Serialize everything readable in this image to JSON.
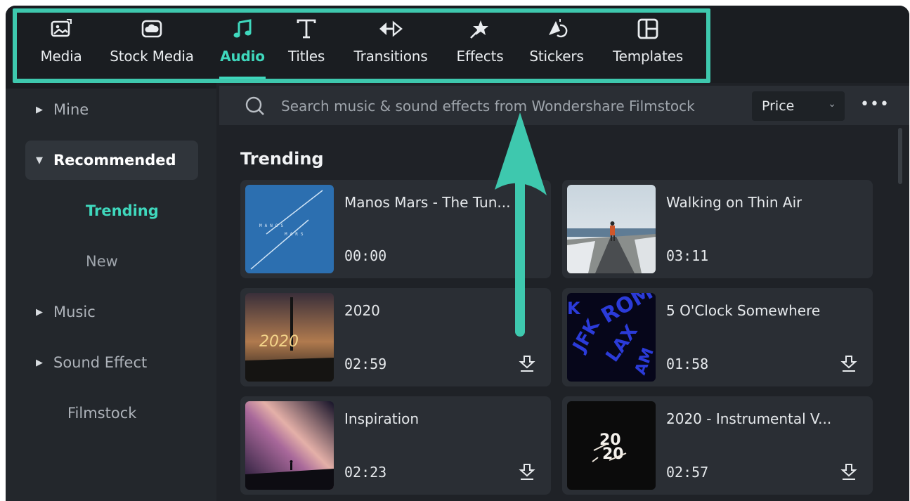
{
  "toolbar": {
    "tabs": [
      {
        "label": "Media",
        "icon": "media-icon"
      },
      {
        "label": "Stock Media",
        "icon": "stock-media-icon"
      },
      {
        "label": "Audio",
        "icon": "music-note-icon",
        "active": true
      },
      {
        "label": "Titles",
        "icon": "titles-icon"
      },
      {
        "label": "Transitions",
        "icon": "transitions-icon"
      },
      {
        "label": "Effects",
        "icon": "effects-icon"
      },
      {
        "label": "Stickers",
        "icon": "stickers-icon"
      },
      {
        "label": "Templates",
        "icon": "templates-icon"
      }
    ]
  },
  "sidebar": {
    "items": [
      {
        "label": "Mine"
      },
      {
        "label": "Recommended"
      },
      {
        "label": "Trending"
      },
      {
        "label": "New"
      },
      {
        "label": "Music"
      },
      {
        "label": "Sound Effect"
      },
      {
        "label": "Filmstock"
      }
    ]
  },
  "search": {
    "placeholder": "Search music & sound effects from Wondershare Filmstock"
  },
  "filter": {
    "price_label": "Price"
  },
  "main": {
    "section_title": "Trending",
    "cards": [
      {
        "title": "Manos Mars - The Tun...",
        "duration": "00:00"
      },
      {
        "title": "Walking on Thin Air",
        "duration": "03:11"
      },
      {
        "title": "2020",
        "duration": "02:59"
      },
      {
        "title": "5 O'Clock Somewhere",
        "duration": "01:58"
      },
      {
        "title": "Inspiration",
        "duration": "02:23"
      },
      {
        "title": "2020 - Instrumental V...",
        "duration": "02:57"
      }
    ]
  },
  "colors": {
    "accent": "#3fd8bd",
    "highlight": "#3ec8ae",
    "background": "#1e2126"
  }
}
